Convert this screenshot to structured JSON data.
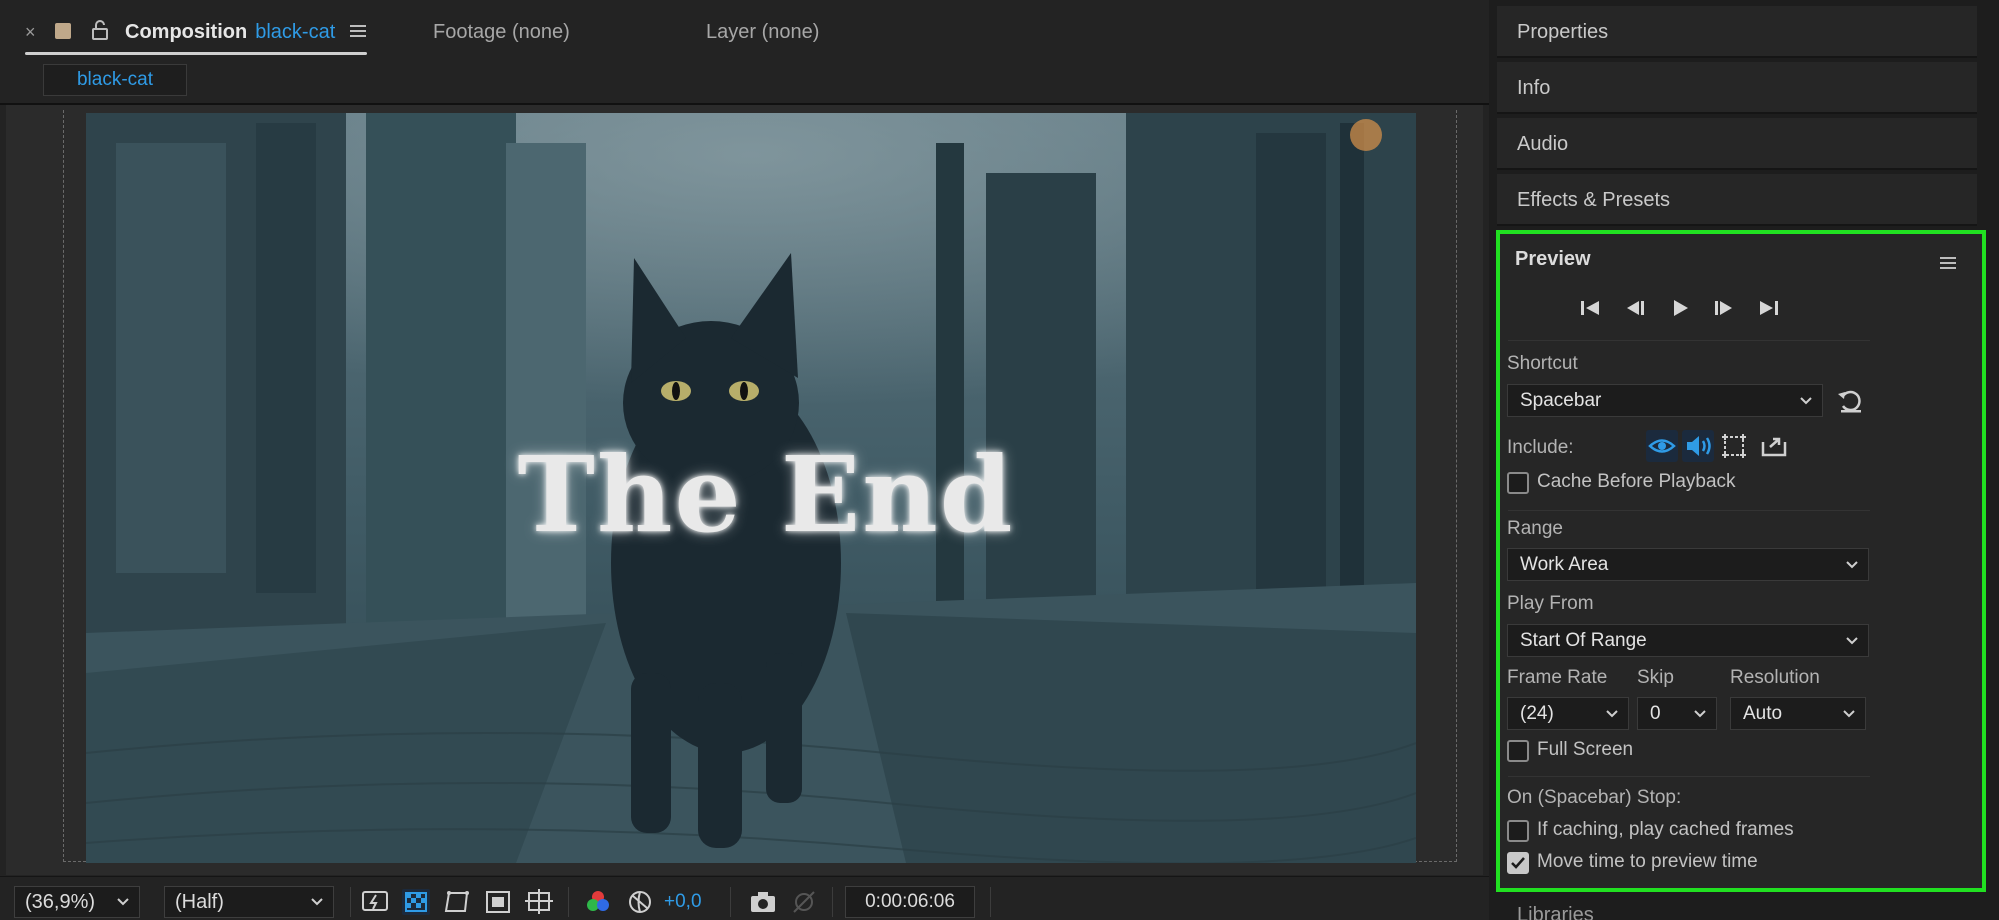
{
  "composition_panel": {
    "tabs": {
      "close_symbol": "×",
      "composition_label": "Composition",
      "composition_name": "black-cat",
      "footage_label": "Footage (none)",
      "layer_label": "Layer (none)"
    },
    "sub_tab": "black-cat",
    "viewer": {
      "title_text": "The End"
    },
    "toolbar": {
      "zoom": "(36,9%)",
      "resolution": "(Half)",
      "exposure_offset": "+0,0",
      "current_time": "0:00:06:06"
    }
  },
  "right_panel": {
    "sections": [
      "Properties",
      "Info",
      "Audio",
      "Effects & Presets"
    ],
    "preview": {
      "title": "Preview",
      "shortcut_label": "Shortcut",
      "shortcut_value": "Spacebar",
      "include_label": "Include:",
      "cache_before_playback": "Cache Before Playback",
      "cache_before_playback_checked": false,
      "range_label": "Range",
      "range_value": "Work Area",
      "play_from_label": "Play From",
      "play_from_value": "Start Of Range",
      "frame_rate_label": "Frame Rate",
      "frame_rate_value": "(24)",
      "skip_label": "Skip",
      "skip_value": "0",
      "resolution_label": "Resolution",
      "resolution_value": "Auto",
      "full_screen": "Full Screen",
      "full_screen_checked": false,
      "on_stop_label": "On (Spacebar) Stop:",
      "if_caching": "If caching, play cached frames",
      "if_caching_checked": false,
      "move_time": "Move time to preview time",
      "move_time_checked": true
    },
    "next_section": "Libraries"
  },
  "colors": {
    "accent_blue": "#2f9be6",
    "highlight_green": "#21e021"
  }
}
